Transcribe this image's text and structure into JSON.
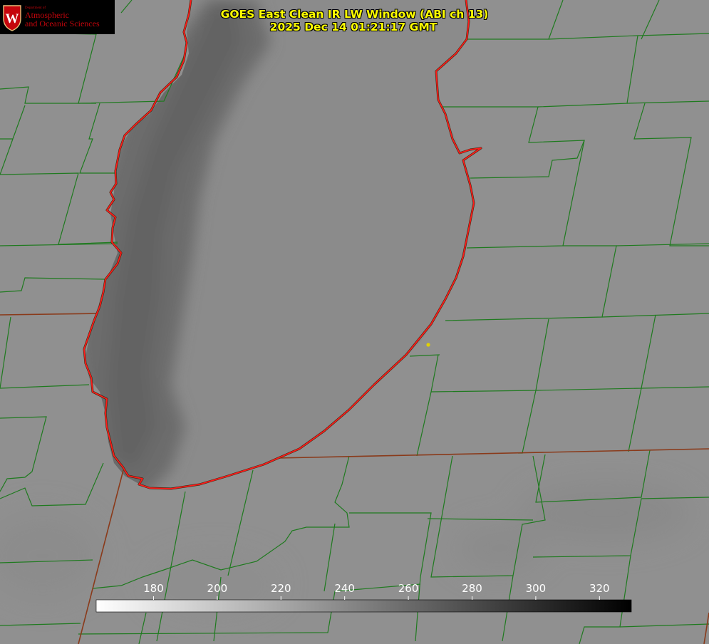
{
  "title": {
    "line1": "GOES East Clean IR LW Window (ABI ch 13)",
    "line2": "2025 Dec 14 01:21:17 GMT"
  },
  "logo": {
    "dept": "Department of",
    "line1": "Atmospheric",
    "line2": "and Oceanic Sciences",
    "crest_letter": "W",
    "color": "#c5050c"
  },
  "colorbar": {
    "min": 162,
    "max": 330,
    "ticks": [
      180,
      200,
      220,
      240,
      260,
      280,
      300,
      320
    ],
    "gradient": [
      "#ffffff",
      "#000000"
    ],
    "tick_color": "#ffffff"
  },
  "map": {
    "background": "#909090",
    "lake_color": "#8a8a8a",
    "lake_dark_color": "#6a6a6a",
    "county_line_color": "#1f7a1f",
    "state_line_color": "#8a3a1a",
    "shoreline_color": "#ff1a1a",
    "marker_color": "#e0d000"
  }
}
